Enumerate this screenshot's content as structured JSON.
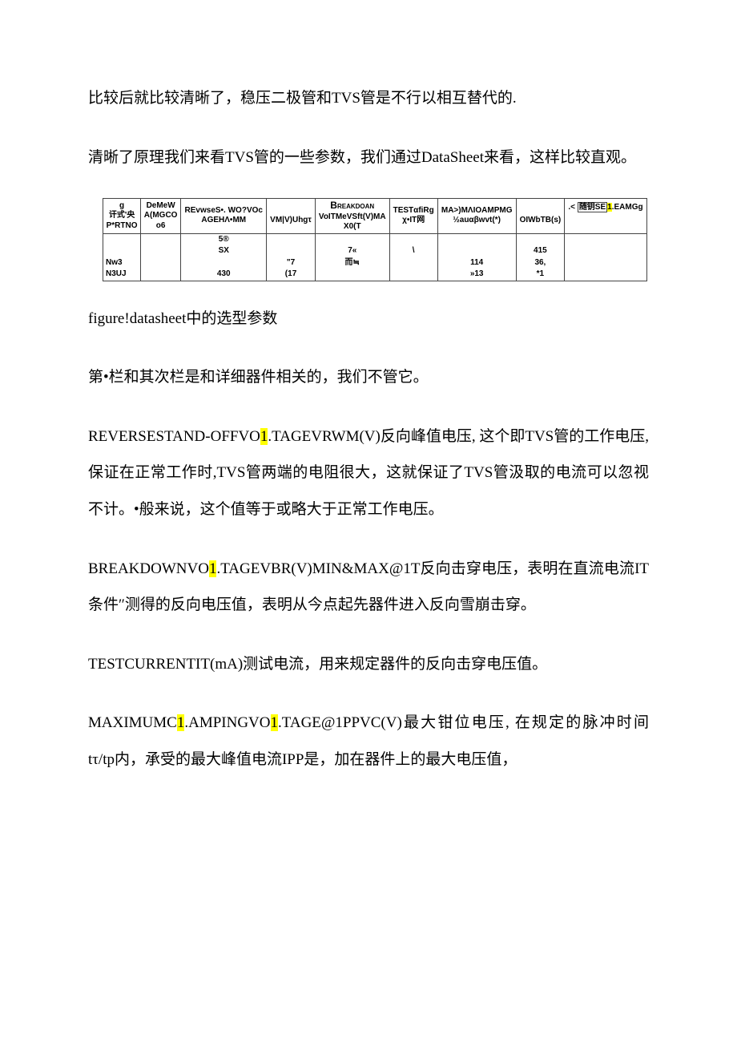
{
  "paragraphs": {
    "p1": "比较后就比较清晰了，稳压二极管和TVS管是不行以相互替代的.",
    "p2": "清晰了原理我们来看TVS管的一些参数，我们通过DataSheet来看，这样比较直观。",
    "caption": "figure!datasheet中的选型参数",
    "p3": "第•栏和其次栏是和详细器件相关的，我们不管它。",
    "p4_a": "REVERSESTAND-OFFVO",
    "p4_h1": "1",
    "p4_b": ".TAGEVRWM(V)反向峰值电压, 这个即TVS管的工作电压, 保证在正常工作时,TVS管两端的电阻很大，这就保证了TVS管汲取的电流可以忽视不计。•般来说，这个值等于或略大于正常工作电压。",
    "p5_a": "BREAKDOWNVO",
    "p5_h1": "1",
    "p5_b": ".TAGEVBR(V)MIN&MAX@1T反向击穿电压，表明在直流电流IT条件″测得的反向电压值，表明从今点起先器件进入反向雪崩击穿。",
    "p6": "TESTCURRENTIT(mA)测试电流，用来规定器件的反向击穿电压值。",
    "p7_a": "MAXIMUMC",
    "p7_h1": "1",
    "p7_b": ".AMPINGVO",
    "p7_h2": "1",
    "p7_c": ".TAGE@1PPVC(V)最大钳位电压, 在规定的脉冲时间tτ/tp内，承受的最大峰值电流IPP是，加在器件上的最大电压值，"
  },
  "table": {
    "headers": {
      "c1_top": "g",
      "c1_mid": "讦式'央",
      "c1_bot": "P*RTNO",
      "c2_top": "DeMeW",
      "c2_mid": "A(MGCO",
      "c2_bot": "o6",
      "c3_top": "REvwseS•. WO?VOc",
      "c3_bot": "AGEHΛ•MM",
      "c4_bot": "VM|V)Uhgτ",
      "c5_top_sc": "Breakdoan",
      "c5_mid": "VoITMeVSft(V)MA",
      "c5_bot": "X0(T",
      "c6_top": "TESTαfiRg",
      "c6_bot": "χ•IT网",
      "c7_top": "MA>)MΛIOAMPMG",
      "c7_bot": "½auαβwvt(*)",
      "c8_bot": "OIWbTB(s)",
      "c9_top_a": ".<",
      "c9_top_b": "随钥SE",
      "c9_top_h": "1",
      "c9_top_c": ".EAMGg"
    },
    "rows": [
      {
        "c1": "",
        "c2": "",
        "c3": "5®",
        "c4": "",
        "c5": "",
        "c6": "",
        "c7": "",
        "c8": "",
        "c9": ""
      },
      {
        "c1": "",
        "c2": "",
        "c3": "SX",
        "c4": "",
        "c5": "7«",
        "c6": "\\",
        "c7": "",
        "c8": "415",
        "c9": ""
      },
      {
        "c1": "Nw3",
        "c2": "",
        "c3": "",
        "c4": "\"7",
        "c5": "而≒",
        "c6": "",
        "c7": "114",
        "c8": "36,",
        "c9": ""
      },
      {
        "c1": "N3UJ",
        "c2": "",
        "c3": "430",
        "c4": "(17",
        "c5": "",
        "c6": "",
        "c7": "»13",
        "c8": "*1",
        "c9": ""
      }
    ]
  }
}
